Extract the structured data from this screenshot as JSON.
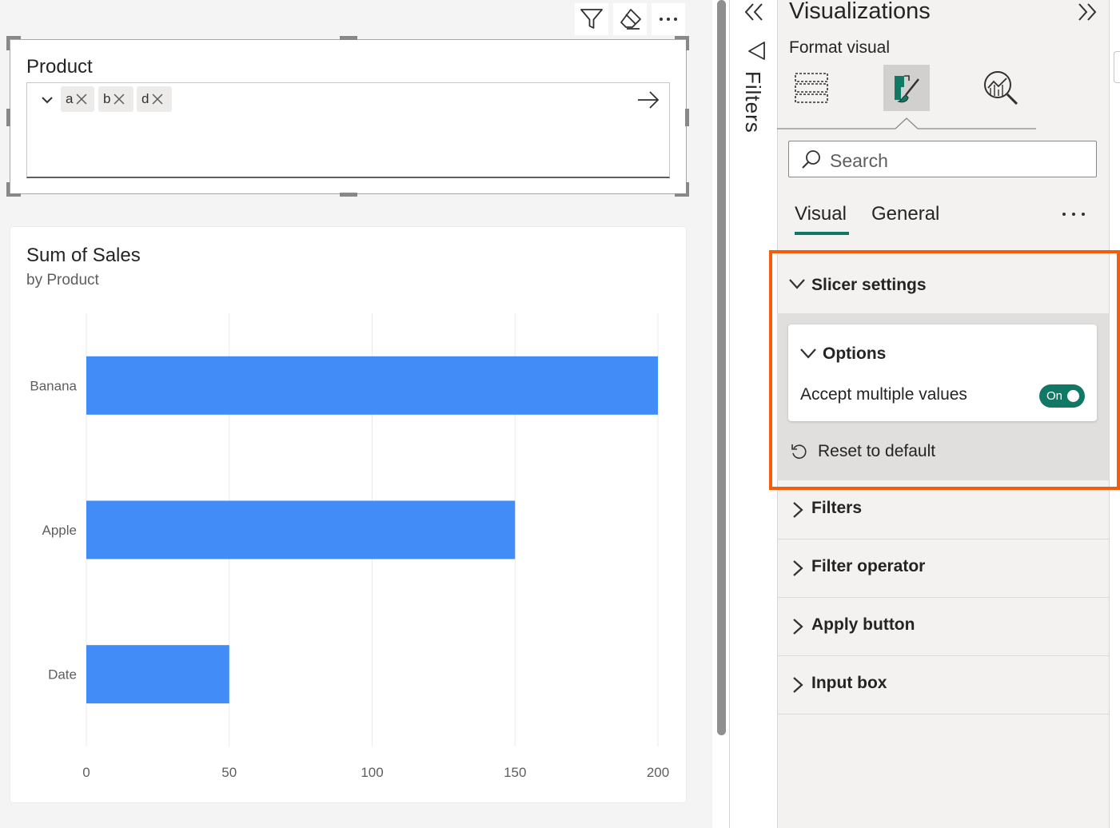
{
  "visual_header": {
    "buttons": [
      "filter-icon",
      "eraser-icon",
      "more-options-icon"
    ]
  },
  "slicer": {
    "title": "Product",
    "chips": [
      "a",
      "b",
      "d"
    ]
  },
  "chart": {
    "title": "Sum of Sales",
    "subtitle": "by Product"
  },
  "chart_data": {
    "type": "bar",
    "orientation": "horizontal",
    "title": "Sum of Sales",
    "subtitle": "by Product",
    "categories": [
      "Banana",
      "Apple",
      "Date"
    ],
    "values": [
      200,
      150,
      50
    ],
    "xticks": [
      0,
      50,
      100,
      150,
      200
    ],
    "xlim": [
      0,
      200
    ],
    "grid": "vertical",
    "bar_color": "#418cf6"
  },
  "filters_pane": {
    "label": "Filters"
  },
  "viz_pane": {
    "title": "Visualizations",
    "format_label": "Format visual",
    "search_placeholder": "Search",
    "tabs": [
      "Visual",
      "General"
    ],
    "slicer_settings": {
      "label": "Slicer settings",
      "options_label": "Options",
      "accept_multiple_label": "Accept multiple values",
      "toggle_label": "On",
      "toggle_on": true,
      "reset_label": "Reset to default"
    },
    "sections": [
      "Filters",
      "Filter operator",
      "Apply button",
      "Input box"
    ]
  },
  "colors": {
    "accent": "#117865",
    "bar": "#418cf6",
    "highlight": "#f55c0a"
  }
}
